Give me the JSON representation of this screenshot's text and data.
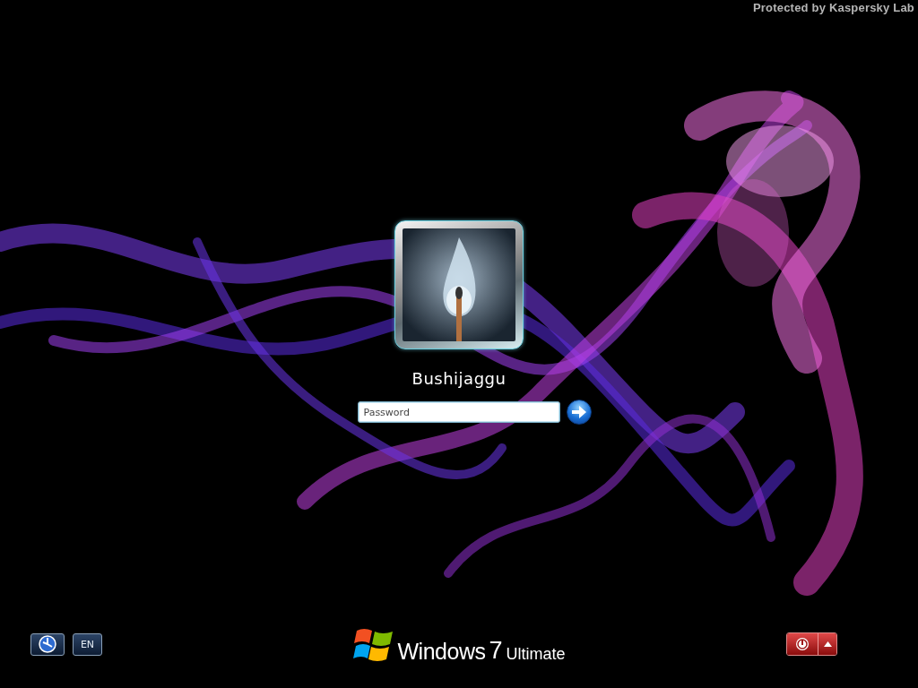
{
  "protection_notice": "Protected by Kaspersky Lab",
  "user": {
    "name": "Bushijaggu"
  },
  "password_field": {
    "placeholder": "Password"
  },
  "bottom_bar": {
    "language": "EN",
    "brand": {
      "name": "Windows",
      "version": "7",
      "edition": "Ultimate"
    }
  }
}
